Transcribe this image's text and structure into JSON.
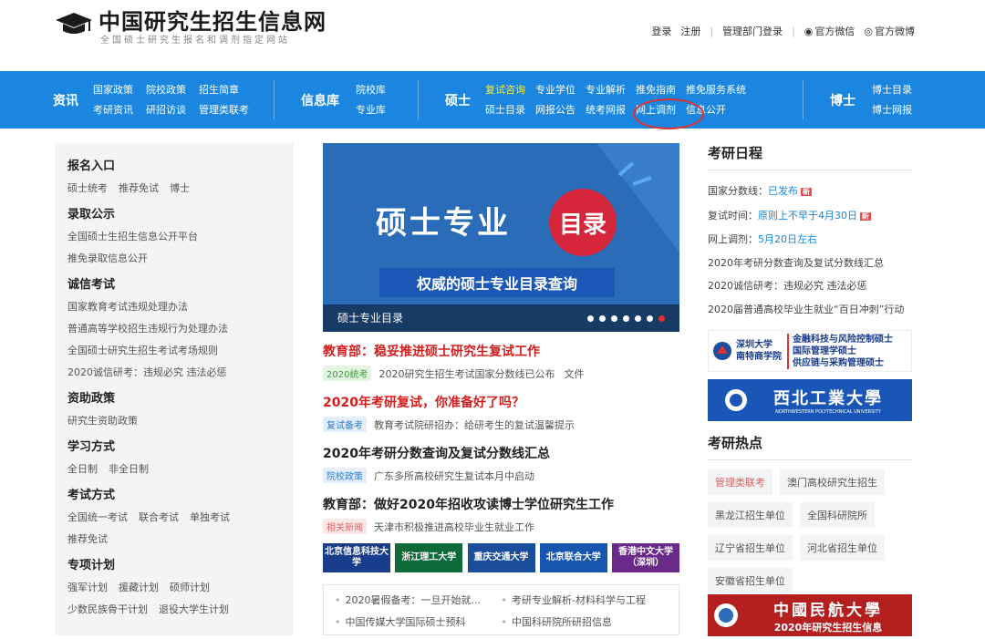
{
  "header": {
    "title": "中国研究生招生信息网",
    "subtitle": "全国硕士研究生报名和调剂指定网站",
    "links": [
      "登录",
      "注册",
      "管理部门登录",
      "官方微信",
      "官方微博"
    ]
  },
  "nav": {
    "zixun": {
      "label": "资讯",
      "items": [
        "国家政策",
        "考研资讯",
        "院校政策",
        "研招访谈",
        "招生简章",
        "管理类联考"
      ]
    },
    "xinxiku": {
      "label": "信息库",
      "items": [
        "院校库",
        "专业库"
      ]
    },
    "shuoshi": {
      "label": "硕士",
      "items": [
        "复试咨询",
        "硕士目录",
        "专业学位",
        "网报公告",
        "专业解析",
        "统考网报",
        "推免指南",
        "网上调剂",
        "推免服务系统",
        "信息公开"
      ]
    },
    "boshi": {
      "label": "博士",
      "items": [
        "博士目录",
        "博士网报"
      ]
    }
  },
  "sidebar": [
    {
      "title": "报名入口",
      "rows": [
        [
          "硕士统考",
          "推荐免试",
          "博士"
        ]
      ]
    },
    {
      "title": "录取公示",
      "rows": [
        [
          "全国硕士生招生信息公开平台"
        ],
        [
          "推免录取信息公开"
        ]
      ]
    },
    {
      "title": "诚信考试",
      "rows": [
        [
          "国家教育考试违规处理办法"
        ],
        [
          "普通高等学校招生违规行为处理办法"
        ],
        [
          "全国硕士研究生招生考试考场规则"
        ],
        [
          "2020诚信研考：违规必究 违法必惩"
        ]
      ]
    },
    {
      "title": "资助政策",
      "rows": [
        [
          "研究生资助政策"
        ]
      ]
    },
    {
      "title": "学习方式",
      "rows": [
        [
          "全日制",
          "非全日制"
        ]
      ]
    },
    {
      "title": "考试方式",
      "rows": [
        [
          "全国统一考试",
          "联合考试",
          "单独考试"
        ],
        [
          "推荐免试"
        ]
      ]
    },
    {
      "title": "专项计划",
      "rows": [
        [
          "强军计划",
          "援藏计划",
          "硕师计划"
        ],
        [
          "少数民族骨干计划",
          "退役大学生计划"
        ]
      ]
    }
  ],
  "banner": {
    "main": "硕士专业",
    "circle": "目录",
    "sub": "权威的硕士专业目录查询",
    "caption": "硕士专业目录"
  },
  "news": [
    {
      "title": "教育部：稳妥推进硕士研究生复试工作",
      "tag": "2020统考",
      "meta": "2020研究生招生考试国家分数线已公布",
      "extra": "文件"
    },
    {
      "title": "2020年考研复试，你准备好了吗？",
      "tag": "复试备考",
      "meta": "教育考试院研招办：给研考生的复试温馨提示",
      "extra": ""
    },
    {
      "title": "2020年考研分数查询及复试分数线汇总",
      "tag": "院校政策",
      "meta": "广东多所高校研究生复试本月中启动",
      "extra": ""
    },
    {
      "title": "教育部：做好2020年招收攻读博士学位研究生工作",
      "tag": "相关新闻",
      "meta": "天津市积极推进高校毕业生就业工作",
      "extra": ""
    }
  ],
  "uni_logos": [
    "北京信息科技大学",
    "浙江理工大学",
    "重庆交通大学",
    "北京联合大学",
    "香港中文大学（深圳）"
  ],
  "links": [
    "2020暑假备考：一旦开始就...",
    "考研专业解析-材料科学与工程",
    "中国传媒大学国际硕士预科",
    "中国科研院所研招信息"
  ],
  "schedule": {
    "title": "考研日程",
    "items": [
      {
        "label": "国家分数线：",
        "value": "已发布",
        "new": true
      },
      {
        "label": "复试时间：",
        "value": "原则上不早于4月30日",
        "new": true
      },
      {
        "label": "网上调剂：",
        "value": "5月20日左右",
        "new": false
      }
    ],
    "news": [
      "2020年考研分数查询及复试分数线汇总",
      "2020诚信研考：违规必究 违法必惩",
      "2020届普通高校毕业生就业“百日冲刺”行动"
    ],
    "new_label": "新"
  },
  "ads": {
    "szu_line1": "深圳大学",
    "szu_line2": "南特商学院",
    "szu_r1": "金融科技与风险控制硕士",
    "szu_r2": "国际管理学硕士",
    "szu_r3": "供应链与采购管理硕士",
    "nwpu": "西北工業大學",
    "nwpu_en": "NORTHWESTERN POLYTECHNICAL UNIVERSITY",
    "cauc1": "中國民航大學",
    "cauc2": "2020年研究生招生信息"
  },
  "hot": {
    "title": "考研热点",
    "items": [
      "管理类联考",
      "澳门高校研究生招生",
      "黑龙江招生单位",
      "全国科研院所",
      "辽宁省招生单位",
      "河北省招生单位",
      "安徽省招生单位"
    ]
  }
}
